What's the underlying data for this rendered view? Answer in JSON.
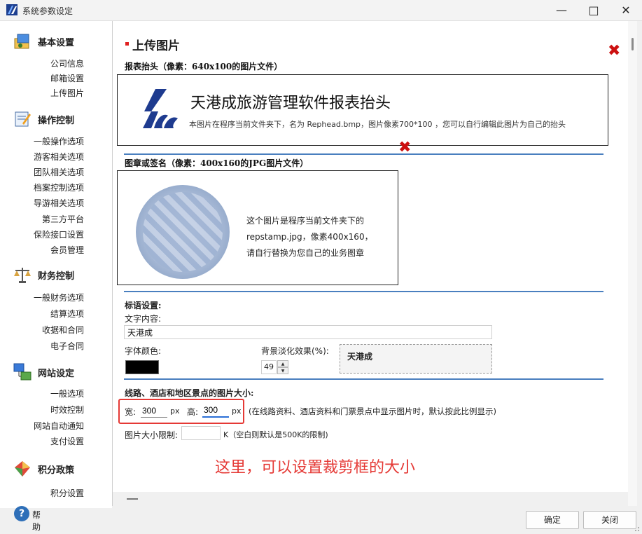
{
  "window": {
    "title": "系统参数设定",
    "icons": {
      "app": "app-logo-icon",
      "minimize": "minimize-icon",
      "maximize": "maximize-icon",
      "close": "close-icon"
    }
  },
  "sidebar": {
    "groups": [
      {
        "title": "基本设置",
        "icon": "basic-settings-icon",
        "items": [
          "公司信息",
          "邮箱设置",
          "上传图片"
        ]
      },
      {
        "title": "操作控制",
        "icon": "operation-control-icon",
        "items": [
          "一般操作选项",
          "游客相关选项",
          "团队相关选项",
          "档案控制选项",
          "导游相关选项",
          "第三方平台",
          "保险接口设置",
          "会员管理"
        ]
      },
      {
        "title": "财务控制",
        "icon": "finance-scale-icon",
        "items": [
          "一般财务选项",
          "结算选项",
          "收据和合同",
          "电子合同"
        ]
      },
      {
        "title": "网站设定",
        "icon": "website-network-icon",
        "items": [
          "一般选项",
          "时效控制",
          "网站自动通知",
          "支付设置"
        ]
      },
      {
        "title": "积分政策",
        "icon": "points-policy-icon",
        "items": [
          "积分设置"
        ]
      }
    ],
    "help": "帮助"
  },
  "content": {
    "page_title": "上传图片",
    "header_section": {
      "label": "报表抬头（像素：640x100的图片文件）",
      "banner_title": "天港成旅游管理软件报表抬头",
      "banner_desc": "本图片在程序当前文件夹下，名为 Rephead.bmp，图片像素700*100 ，您可以自行编辑此图片为自己的抬头"
    },
    "stamp_section": {
      "label": "图章或签名（像素：400x160的JPG图片文件）",
      "lines": [
        "这个图片是程序当前文件夹下的",
        "repstamp.jpg，像素400x160，",
        "请自行替换为您自己的业务图章"
      ]
    },
    "slogan": {
      "heading": "标语设置:",
      "text_label": "文字内容:",
      "text_value": "天港成",
      "color_label": "字体颜色:",
      "color_value": "#000000",
      "fade_label": "背景淡化效果(%):",
      "fade_value": "49",
      "preview_text": "天港成"
    },
    "image_size": {
      "heading": "线路、酒店和地区景点的图片大小:",
      "width_label": "宽:",
      "width_value": "300",
      "height_label": "高:",
      "height_value": "300",
      "unit": "px",
      "note": "(在线路资料、酒店资料和门票景点中显示图片时，默认按此比例显示)",
      "limit_label": "图片大小限制:",
      "limit_value": "",
      "limit_unit": "K（空白则默认是500K的限制)"
    },
    "annotation": "这里，可以设置裁剪框的大小",
    "delete_icon": "delete-x-icon"
  },
  "footer": {
    "ok": "确定",
    "close": "关闭"
  },
  "colors": {
    "accent_red": "#e53935",
    "divider_blue": "#4a7fbf",
    "delete_red": "#cc1111"
  }
}
